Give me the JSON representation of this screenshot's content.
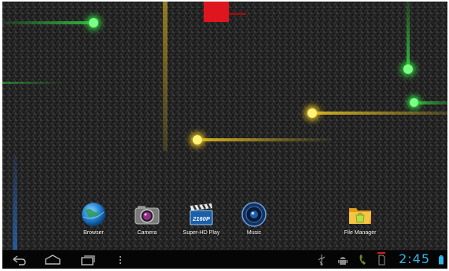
{
  "wallpaper": {
    "base_color": "#242424",
    "streak_colors": [
      "#2fcf3c",
      "#e8c21c",
      "#e0161e",
      "#2a6fc9"
    ]
  },
  "desktop": {
    "apps": [
      {
        "label": "Browser",
        "icon": "globe-icon"
      },
      {
        "label": "Camera",
        "icon": "camera-icon"
      },
      {
        "label": "Super-HD Play",
        "icon": "clapperboard-icon",
        "icon_text": "2160P"
      },
      {
        "label": "Music",
        "icon": "speaker-icon"
      },
      {
        "label": "File Manager",
        "icon": "folder-icon"
      }
    ]
  },
  "navbar": {
    "buttons": [
      "back-icon",
      "home-icon",
      "recent-apps-icon",
      "menu-icon"
    ],
    "status_icons": [
      "usb-icon",
      "android-debug-icon",
      "phone-icon",
      "sd-card-icon",
      "battery-icon"
    ],
    "clock": "2:45",
    "accent_color": "#33b5e5"
  }
}
